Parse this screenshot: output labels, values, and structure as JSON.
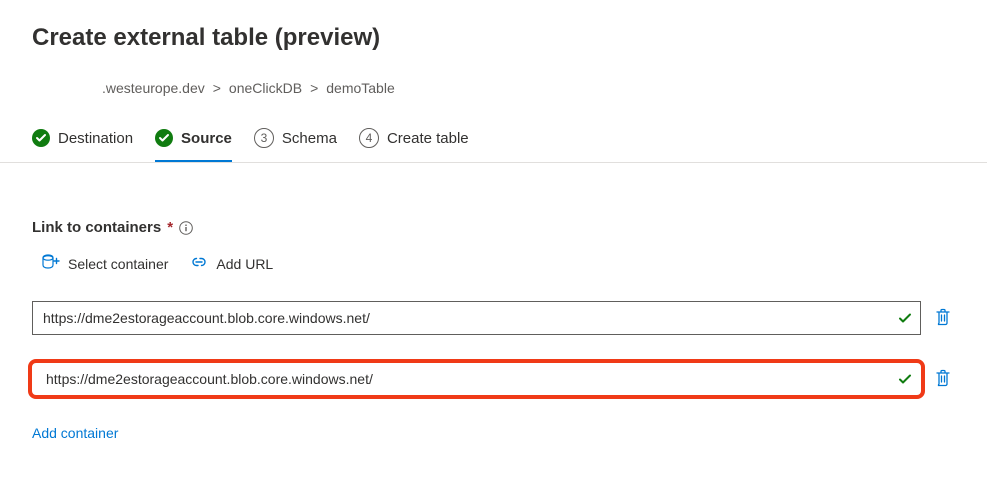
{
  "title": "Create external table (preview)",
  "breadcrumb": {
    "items": [
      {
        "label": ".westeurope.dev"
      },
      {
        "label": "oneClickDB"
      },
      {
        "label": "demoTable"
      }
    ],
    "separator": ">"
  },
  "steps": [
    {
      "label": "Destination",
      "status": "done"
    },
    {
      "label": "Source",
      "status": "done",
      "active": true
    },
    {
      "label": "Schema",
      "number": "3",
      "status": "pending"
    },
    {
      "label": "Create table",
      "number": "4",
      "status": "pending"
    }
  ],
  "section": {
    "label": "Link to containers",
    "required_star": "*"
  },
  "actions": {
    "select_container": "Select container",
    "add_url": "Add URL"
  },
  "containers": [
    {
      "url": "https://dme2estorageaccount.blob.core.windows.net/"
    },
    {
      "url": "https://dme2estorageaccount.blob.core.windows.net/"
    }
  ],
  "add_container_label": "Add container"
}
